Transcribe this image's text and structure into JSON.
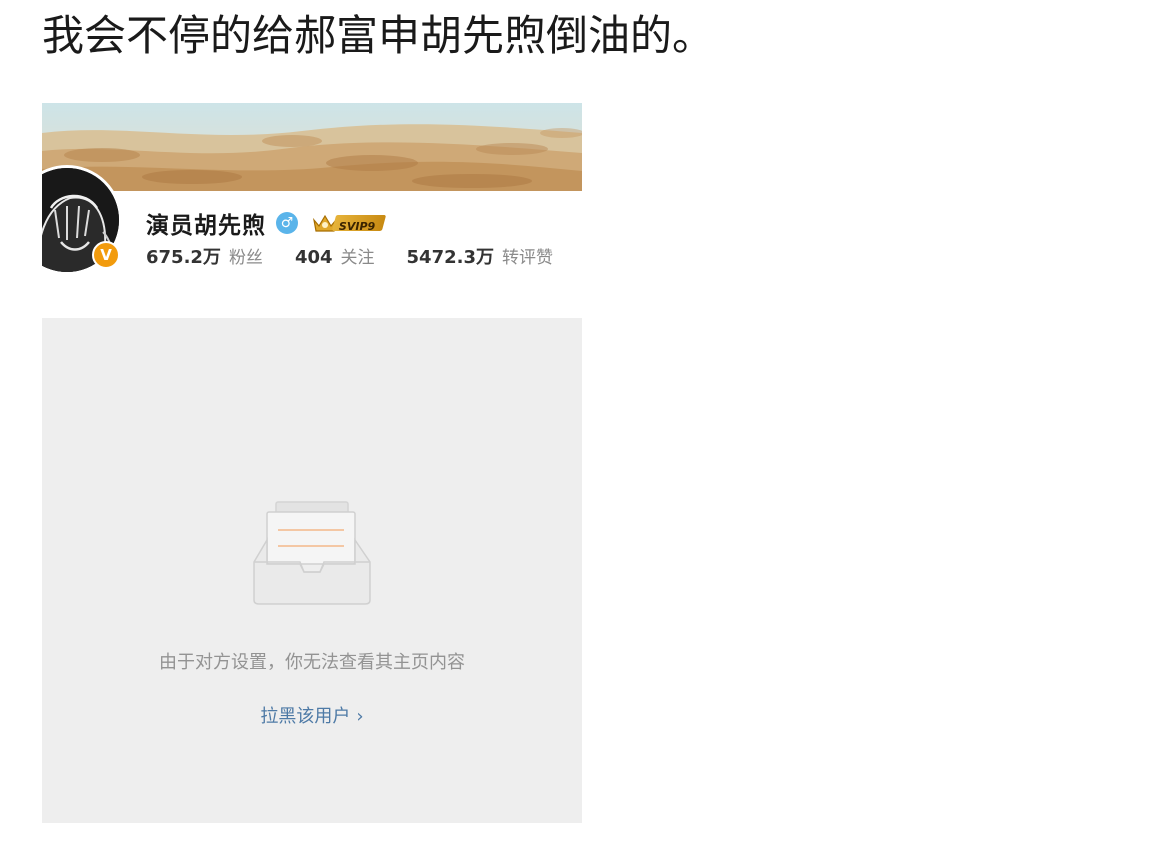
{
  "post": {
    "text": "我会不停的给郝富申胡先煦倒油的。"
  },
  "profile": {
    "name": "演员胡先煦",
    "gender_symbol": "♂",
    "verify_symbol": "V",
    "svip_label": "SVIP9",
    "stats": [
      {
        "value": "675.2万",
        "label": "粉丝"
      },
      {
        "value": "404",
        "label": "关注"
      },
      {
        "value": "5472.3万",
        "label": "转评赞"
      }
    ]
  },
  "blocked": {
    "message": "由于对方设置，你无法查看其主页内容",
    "action_label": "拉黑该用户",
    "action_chevron": "›"
  },
  "colors": {
    "link": "#4e7aa6",
    "gender_badge": "#5ab4ea",
    "verify_badge": "#f29b0d",
    "panel_bg": "#eeeeee"
  }
}
